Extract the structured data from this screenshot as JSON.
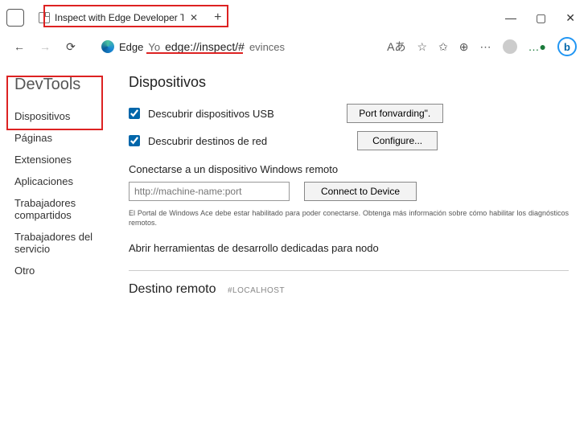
{
  "window": {
    "tab_title": "Inspect with Edge Developer To",
    "new_tab_tooltip": "+"
  },
  "toolbar": {
    "edge_label": "Edge",
    "url_pre": "Yo",
    "url": "edge://inspect/#",
    "url_suf": "evinces",
    "back": "←",
    "forward": "→",
    "refresh": "⟳",
    "read_aloud": "Aあ",
    "fav": "☆",
    "favorites": "✩",
    "collections": "⊕",
    "extensions": "⋯",
    "more_dots": "…●"
  },
  "sidebar": {
    "title": "DevTools",
    "items": [
      {
        "label": "Dispositivos"
      },
      {
        "label": "Páginas"
      },
      {
        "label": "Extensiones"
      },
      {
        "label": "Aplicaciones"
      },
      {
        "label": "Trabajadores compartidos"
      },
      {
        "label": "Trabajadores del servicio"
      },
      {
        "label": "Otro"
      }
    ]
  },
  "content": {
    "heading": "Dispositivos",
    "usb_checkbox": "Descubrir dispositivos USB",
    "port_forward_btn": "Port fonvarding\".",
    "net_checkbox": "Descubrir destinos de red",
    "configure_btn": "Configure...",
    "remote_win_label": "Conectarse a un dispositivo Windows remoto",
    "machine_placeholder": "http://machine-name:port",
    "connect_btn": "Connect to Device",
    "portal_note": "El Portal de Windows Ace debe estar habilitado para poder conectarse. Obtenga más información sobre cómo habilitar los diagnósticos remotos.",
    "node_link": "Abrir herramientas de desarrollo dedicadas para nodo",
    "remote_target_heading": "Destino remoto",
    "remote_target_tag": "#LOCALHOST"
  }
}
